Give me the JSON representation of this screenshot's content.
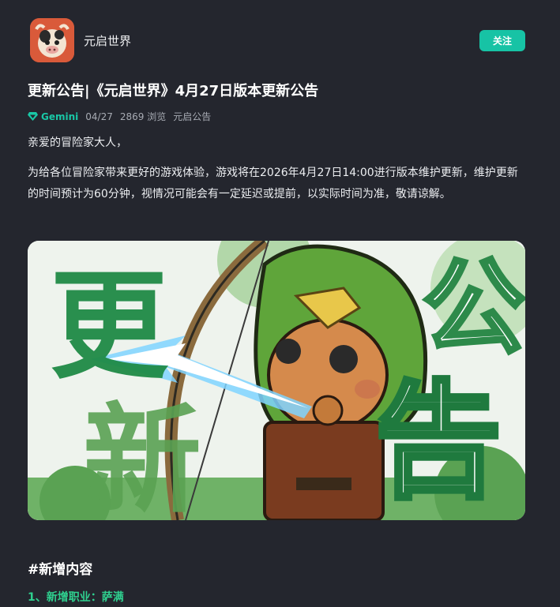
{
  "header": {
    "app_name": "元启世界",
    "follow_label": "关注"
  },
  "post": {
    "title": "更新公告|《元启世界》4月27日版本更新公告",
    "author": "Gemini",
    "date": "04/27",
    "views": "2869 浏览",
    "category": "元启公告",
    "greeting": "亲爱的冒险家大人，",
    "body": "为给各位冒险家带来更好的游戏体验，游戏将在2026年4月27日14:00进行版本维护更新，维护更新的时间预计为60分钟，视情况可能会有一定延迟或提前，以实际时间为准，敬请谅解。",
    "banner": {
      "chars": [
        "更",
        "新",
        "公",
        "告"
      ]
    },
    "section_heading": "#新增内容",
    "sub_heading": "1、新增职业：萨满"
  },
  "colors": {
    "background": "#24262e",
    "accent": "#17c3a5",
    "section_green": "#2fd08f"
  }
}
